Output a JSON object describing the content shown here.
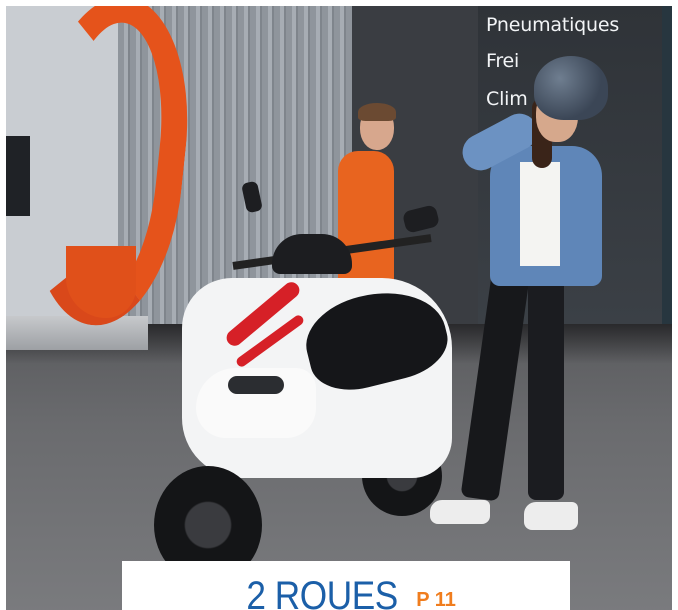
{
  "photo": {
    "sign_lines": [
      "Pneumatiques",
      "Frei",
      "Clim"
    ]
  },
  "caption": {
    "title": "2 ROUES",
    "page_ref": "P 11"
  },
  "colors": {
    "title_blue": "#1b5fa8",
    "page_orange": "#f07d1e",
    "arc_orange": "#e5531b",
    "scooter_red": "#d62027"
  }
}
